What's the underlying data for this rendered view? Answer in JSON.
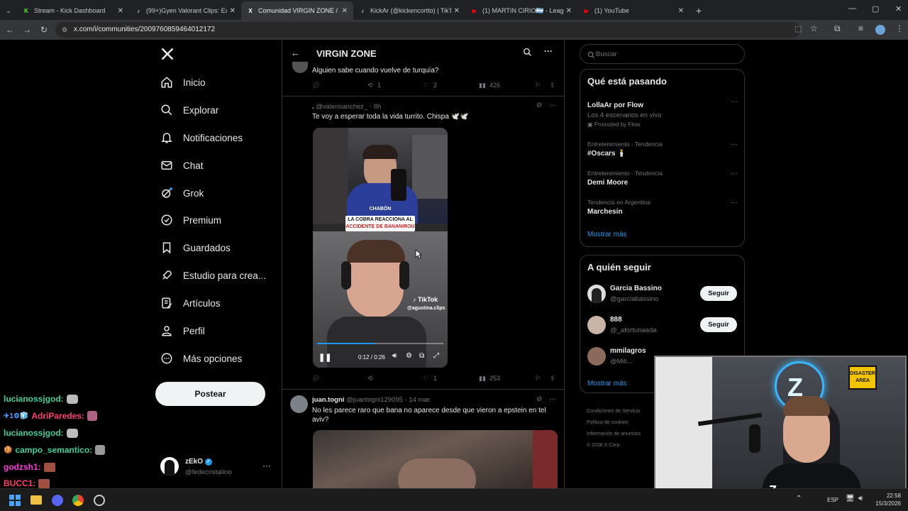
{
  "browser": {
    "tabs": [
      {
        "title": "Stream - Kick Dashboard",
        "fav": "K",
        "favColor": "#53fc18"
      },
      {
        "title": "(99+)Gyen Valorant Clips: Excit",
        "fav": "♪",
        "favColor": "#ffffff"
      },
      {
        "title": "Comunidad VIRGIN ZONE /",
        "fav": "X",
        "favColor": "#ffffff",
        "active": true
      },
      {
        "title": "KickAr (@kickencortto) | TikTok",
        "fav": "♪",
        "favColor": "#ffffff"
      },
      {
        "title": "(1) MARTIN CIRIO🇦🇷 - League",
        "fav": "▶",
        "favColor": "#ff0000"
      },
      {
        "title": "(1) YouTube",
        "fav": "▶",
        "favColor": "#ff0000"
      }
    ],
    "url": "x.com/i/communities/2009760859464012172"
  },
  "nav": {
    "items": [
      "Inicio",
      "Explorar",
      "Notificaciones",
      "Chat",
      "Grok",
      "Premium",
      "Guardados",
      "Estudio para crea...",
      "Artículos",
      "Perfil",
      "Más opciones"
    ],
    "post_label": "Postear",
    "account_name": "zEkO",
    "account_handle": "@fedecristalino"
  },
  "header": {
    "title": "VIRGIN ZONE"
  },
  "tweets": {
    "t0": {
      "text": "Alguien sabe cuando vuelve de turquía?",
      "retweets": "1",
      "likes": "2",
      "views": "426"
    },
    "t1": {
      "name": ".",
      "handle": "@valensanchez_",
      "time": "· 8h",
      "text": "Te voy a esperar toda la vida turrito. Chispa 🕊️🕊️",
      "video_top_label": "CHABÓN",
      "video_banner_line1": "LA COBRA REACCIONA AL",
      "video_banner_line2": "ACCIDENTE DE BANANIROU",
      "tiktok_label": "TikTok",
      "tiktok_user": "@agustina.clips",
      "time_display": "0:12 / 0:26",
      "progress": 0.46,
      "likes": "1",
      "views": "253"
    },
    "t2": {
      "name": "juan.togni",
      "handle": "@juantogni129095",
      "time": "· 14 mar.",
      "text_line1": "No les parece raro que bana no aparece desde que vieron a epstein en tel",
      "text_line2": "aviv?"
    }
  },
  "right": {
    "search_placeholder": "Buscar",
    "trends_title": "Qué está pasando",
    "trends": [
      {
        "cat": "",
        "name": "LollaAr por Flow",
        "sub": "Los 4 escenarios en vivo",
        "promo": "Promoted by Flow"
      },
      {
        "cat": "Entretenimiento · Tendencia",
        "name": "#Oscars 🕯️"
      },
      {
        "cat": "Entretenimiento · Tendencia",
        "name": "Demi Moore"
      },
      {
        "cat": "Tendencia en Argentina",
        "name": "Marchesin"
      }
    ],
    "show_more": "Mostrar más",
    "follow_title": "A quién seguir",
    "follow": [
      {
        "name": "Garcia Bassino",
        "handle": "@garciabassino",
        "btn": "Seguir"
      },
      {
        "name": "888",
        "handle": "@_afortunaada",
        "btn": "Seguir"
      },
      {
        "name": "mmilagros",
        "handle": "@Mili...",
        "btn": ""
      }
    ],
    "follow_more": "Mostrar más",
    "footer_l1": "Condiciones de Servicio",
    "footer_l2": "Política de cookies",
    "footer_l3": "Información de anuncios",
    "footer_l4": "© 2026 X Corp."
  },
  "chat": [
    {
      "user": "lucianossjgod:",
      "color": "#3ecf9e"
    },
    {
      "user": "AdriParedes:",
      "color": "#ff3d6b",
      "prefix": "✈1⚙🧊"
    },
    {
      "user": "lucianossjgod:",
      "color": "#3ecf9e"
    },
    {
      "user": "campo_semantico:",
      "color": "#3ecf9e",
      "prefix": "🍪"
    },
    {
      "user": "godzsh1:",
      "color": "#ff3ddf"
    },
    {
      "user": "BUCC1:",
      "color": "#ff3d6b"
    }
  ],
  "cam": {
    "sign_line1": "DISASTER",
    "sign_line2": "AREA"
  },
  "taskbar": {
    "lang": "ESP",
    "time": "22:58",
    "date": "15/3/2026"
  }
}
